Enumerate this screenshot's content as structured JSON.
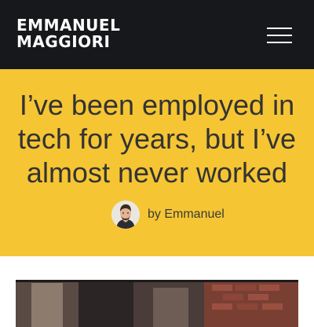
{
  "header": {
    "logo_line1": "EMMANUEL",
    "logo_line2": "MAGGIORI",
    "menu_icon": "hamburger-menu-icon",
    "background_color": "#16181b"
  },
  "hero": {
    "background_color": "#f5c533",
    "title": "I’ve been employed in tech for years, but I’ve almost never worked",
    "byline": "by Emmanuel"
  }
}
